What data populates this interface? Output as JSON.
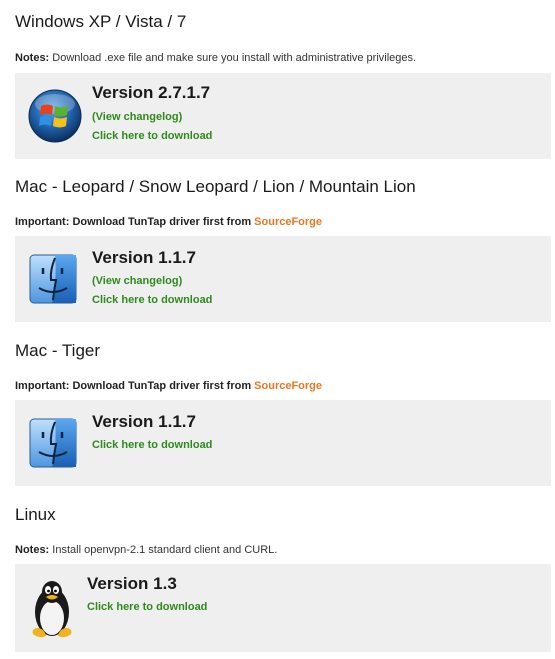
{
  "sections": [
    {
      "title": "Windows XP / Vista / 7",
      "note_label": "Notes:",
      "note_text": "Download .exe file and make sure you install with administrative privileges.",
      "icon": "windows-logo-icon",
      "version": "Version 2.7.1.7",
      "changelog_open": "(",
      "changelog": "View changelog",
      "changelog_close": ")",
      "download": "Click here to download"
    },
    {
      "title": "Mac - Leopard / Snow Leopard / Lion / Mountain Lion",
      "note_label": "Important:",
      "note_text": "Download TunTap driver first from",
      "note_link": "SourceForge",
      "icon": "mac-finder-icon",
      "version": "Version 1.1.7",
      "changelog_open": "(",
      "changelog": "View changelog",
      "changelog_close": ")",
      "download": "Click here to download"
    },
    {
      "title": "Mac - Tiger",
      "note_label": "Important:",
      "note_text": "Download TunTap driver first from",
      "note_link": "SourceForge",
      "icon": "mac-finder-icon",
      "version": "Version 1.1.7",
      "download": "Click here to download"
    },
    {
      "title": "Linux",
      "note_label": "Notes:",
      "note_text": "Install openvpn-2.1 standard client and CURL.",
      "icon": "linux-tux-icon",
      "version": "Version 1.3",
      "download": "Click here to download"
    }
  ],
  "colors": {
    "link_green": "#2e8b1c",
    "link_orange": "#e87722",
    "box_background": "#efefef"
  }
}
